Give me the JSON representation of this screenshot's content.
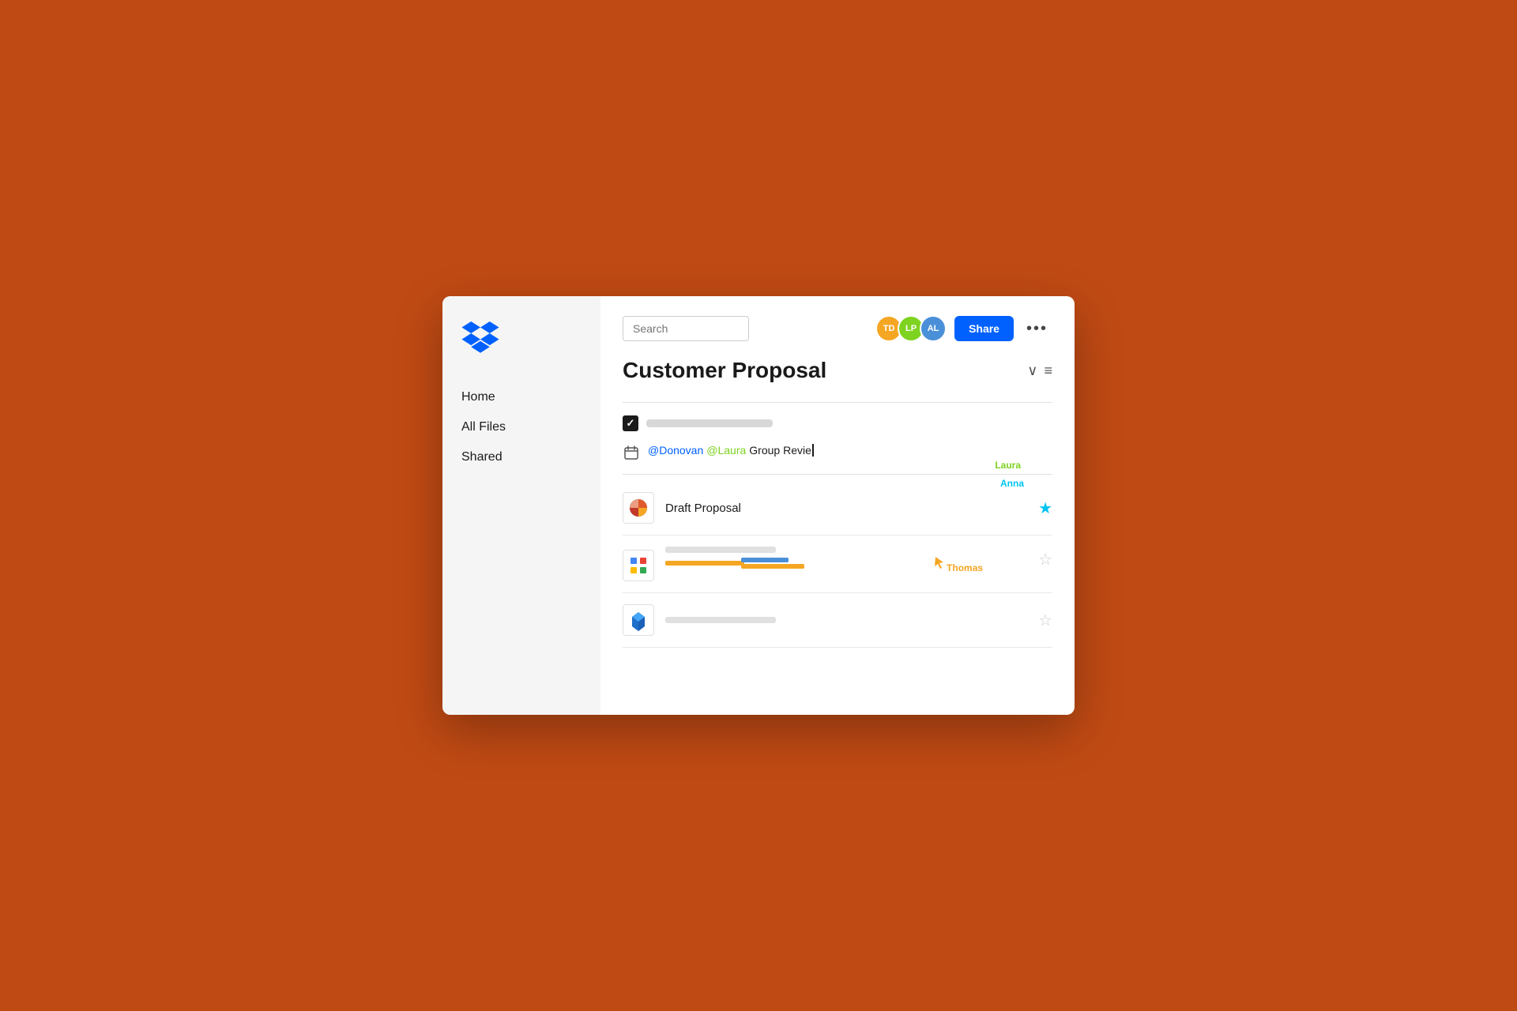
{
  "background": "#C04A14",
  "sidebar": {
    "nav_items": [
      {
        "label": "Home",
        "id": "home"
      },
      {
        "label": "All Files",
        "id": "all-files"
      },
      {
        "label": "Shared",
        "id": "shared"
      }
    ]
  },
  "header": {
    "search_placeholder": "Search",
    "avatars": [
      {
        "initials": "TD",
        "color": "#f5a623",
        "id": "td"
      },
      {
        "initials": "LP",
        "color": "#7ed321",
        "id": "lp"
      },
      {
        "initials": "AL",
        "color": "#4a90d9",
        "id": "al"
      }
    ],
    "share_label": "Share",
    "more_label": "•••"
  },
  "document": {
    "title": "Customer Proposal",
    "collapse_icon": "∨",
    "menu_icon": "≡"
  },
  "content": {
    "checklist_item": "",
    "calendar_row": {
      "mention1": "@Donovan",
      "mention2": "@Laura",
      "text": " Group Revie",
      "cursor_label": "Laura"
    }
  },
  "files": [
    {
      "name": "Draft Proposal",
      "icon_type": "pie",
      "star_filled": true,
      "cursor_label": "Anna",
      "id": "draft-proposal"
    },
    {
      "name": "",
      "icon_type": "grid",
      "star_filled": false,
      "cursor_label": "Thomas",
      "id": "file-2"
    },
    {
      "name": "",
      "icon_type": "paper",
      "star_filled": false,
      "cursor_label": "",
      "id": "file-3"
    }
  ]
}
